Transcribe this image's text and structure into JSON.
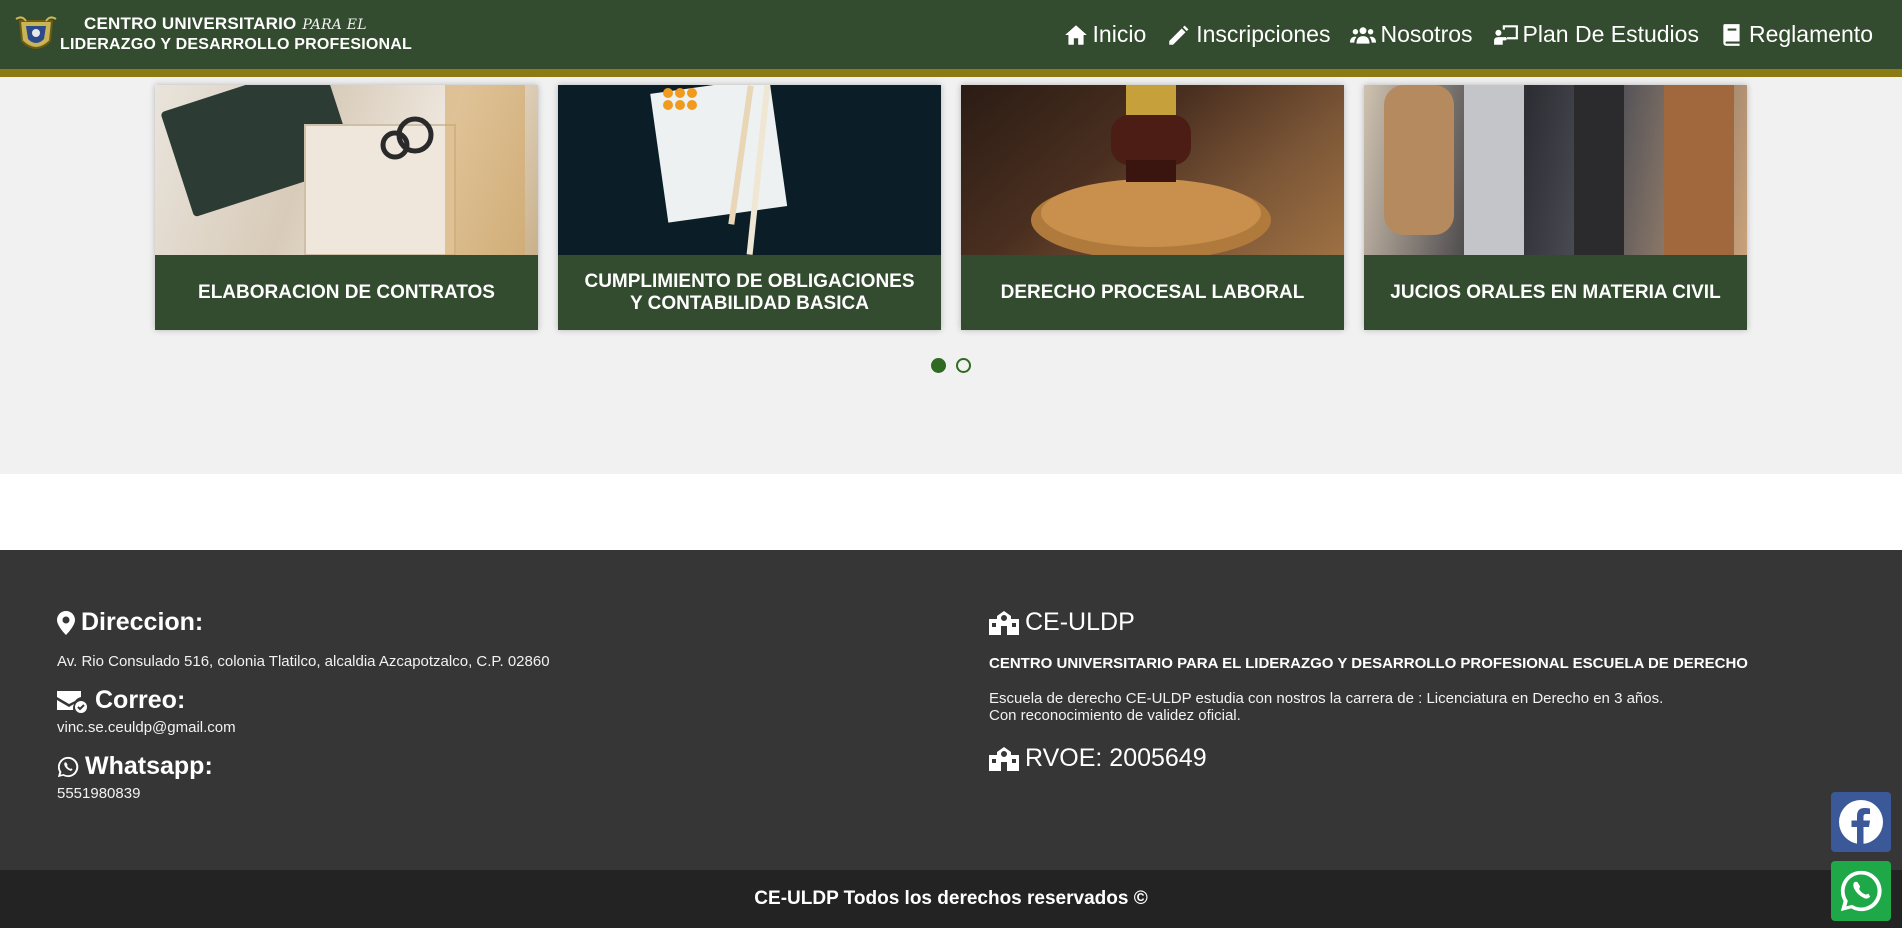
{
  "brand": {
    "line1": "CENTRO UNIVERSITARIO",
    "line1_script": "PARA EL",
    "line2": "LIDERAZGO Y DESARROLLO PROFESIONAL"
  },
  "nav": [
    {
      "label": "Inicio",
      "icon": "home-icon"
    },
    {
      "label": "Inscripciones",
      "icon": "pencil-icon"
    },
    {
      "label": "Nosotros",
      "icon": "users-icon"
    },
    {
      "label": "Plan De Estudios",
      "icon": "chalkboard-teacher-icon"
    },
    {
      "label": "Reglamento",
      "icon": "book-icon"
    }
  ],
  "carousel": {
    "cards": [
      {
        "title": "ELABORACION DE CONTRATOS"
      },
      {
        "title": "CUMPLIMIENTO DE OBLIGACIONES Y CONTABILIDAD BASICA"
      },
      {
        "title": "DERECHO PROCESAL LABORAL"
      },
      {
        "title": "JUCIOS ORALES EN MATERIA CIVIL"
      }
    ],
    "pages": 2,
    "active_page": 1
  },
  "footer": {
    "address": {
      "title": "Direccion:",
      "text": "Av. Rio Consulado 516, colonia Tlatilco, alcaldia Azcapotzalco, C.P. 02860"
    },
    "email": {
      "title": "Correo:",
      "text": "vinc.se.ceuldp@gmail.com"
    },
    "whatsapp": {
      "title": "Whatsapp:",
      "text": "5551980839"
    },
    "org": {
      "title": "CE-ULDP",
      "fullname": "CENTRO UNIVERSITARIO PARA EL LIDERAZGO Y DESARROLLO PROFESIONAL ESCUELA DE DERECHO",
      "desc1": "Escuela de derecho CE-ULDP estudia con nostros la carrera de : Licenciatura en Derecho en 3 años.",
      "desc2": "Con reconocimiento de validez oficial."
    },
    "rvoe": "RVOE: 2005649",
    "copyright": "CE-ULDP Todos los derechos reservados ©"
  },
  "colors": {
    "nav_bg": "#334b2e",
    "nav_border": "#8b7b12",
    "footer_bg": "#363636",
    "copyright_bg": "#232323",
    "dot_active": "#2f6b22",
    "facebook": "#3b5998",
    "whatsapp": "#1fa847"
  }
}
